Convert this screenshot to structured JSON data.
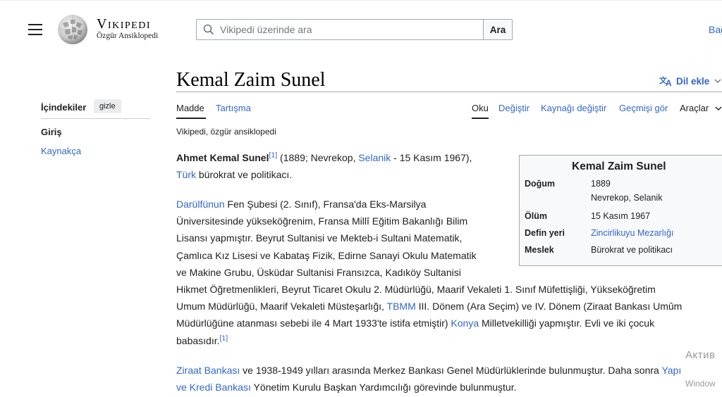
{
  "header": {
    "logo_title": "Vikipedi",
    "logo_subtitle": "Özgür Ansiklopedi",
    "search_placeholder": "Vikipedi üzerinde ara",
    "search_button": "Ara",
    "donate_link": "Bağ"
  },
  "page": {
    "title": "Kemal Zaim Sunel",
    "lang_button": "Dil ekle",
    "tagline": "Vikipedi, özgür ansiklopedi"
  },
  "tabs": {
    "article": "Madde",
    "talk": "Tartışma",
    "read": "Oku",
    "edit": "Değiştir",
    "edit_source": "Kaynağı değiştir",
    "history": "Geçmişi gör",
    "tools": "Araçlar"
  },
  "toc": {
    "title": "İçindekiler",
    "hide": "gizle",
    "items": [
      "Giriş",
      "Kaynakça"
    ]
  },
  "infobox": {
    "title": "Kemal Zaim Sunel",
    "rows": [
      {
        "label": "Doğum",
        "value": "1889",
        "value2": "Nevrekop, Selanik"
      },
      {
        "label": "Ölüm",
        "value": "15 Kasım 1967"
      },
      {
        "label": "Defin yeri",
        "value": "Zincirlikuyu Mezarlığı"
      },
      {
        "label": "Meslek",
        "value": "Bürokrat ve politikacı"
      }
    ]
  },
  "body": {
    "p1": {
      "bold": "Ahmet Kemal Sunel",
      "ref": "[1]",
      "t1": " (1889; Nevrekop, ",
      "link_selanik": "Selanik",
      "t2": " - 15 Kasım 1967),",
      "link_turk": "Türk",
      "t3": " bürokrat ve politikacı."
    },
    "p2": {
      "link_darulfunun": "Darülfünun",
      "l1": " Fen Şubesi (2. Sınıf), Fransa'da Eks-Marsilya",
      "l2": "Üniversitesinde yükseköğrenim, Fransa Millî Eğitim Bakanlığı Bilim",
      "l3": "Lisansı yapmıştır. Beyrut Sultanisi ve Mekteb-i Sultani Matematik,",
      "l4": "Çamlıca Kız Lisesi ve Kabataş Fizik, Edirne Sanayi Okulu Matematik",
      "l5": "ve Makine Grubu, Üsküdar Sultanisi Fransızca, Kadıköy Sultanisi",
      "l6": "Hikmet Öğretmenlikleri, Beyrut Ticaret Okulu 2. Müdürlüğü, Maarif Vekaleti 1. Sınıf Müfettişliği, Yükseköğretim",
      "l7a": "Umum Müdürlüğü, Maarif Vekaleti Müsteşarlığı, ",
      "link_tbmm": "TBMM",
      "l7b": " III. Dönem (Ara Seçim) ve IV. Dönem (Ziraat Bankası Umûm",
      "l8a": "Müdürlüğüne atanması sebebi ile 4 Mart 1933'te istifa etmiştir) ",
      "link_konya": "Konya",
      "l8b": " Milletvekilliği yapmıştır. Evli ve iki çocuk",
      "l9": "babasıdır.",
      "ref": "[1]"
    },
    "p3": {
      "link_ziraat": "Ziraat Bankası",
      "l1": " ve 1938-1949 yılları arasında Merkez Bankası Genel Müdürlüklerinde bulunmuştur. Daha sonra ",
      "link_yapi1": "Yapı",
      "link_yapi2": "ve Kredi Bankası",
      "l2": " Yönetim Kurulu Başkan Yardımcılığı görevinde bulunmuştur."
    }
  },
  "watermark": {
    "line1": "Актив",
    "line2": "Window"
  }
}
